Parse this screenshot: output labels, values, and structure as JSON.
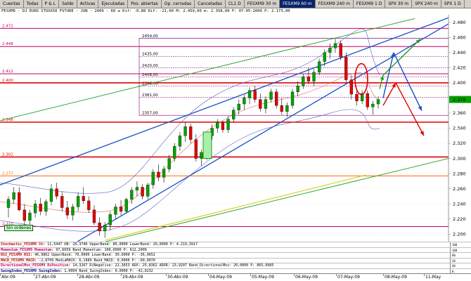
{
  "tabs": [
    {
      "label": "Cuentas",
      "active": false
    },
    {
      "label": "Todas",
      "active": false
    },
    {
      "label": "P & L",
      "active": false
    },
    {
      "label": "Saldo",
      "active": false
    },
    {
      "label": "Activas",
      "active": false
    },
    {
      "label": "Ejecutadas",
      "active": false
    },
    {
      "label": "Pos. abiertas",
      "active": false
    },
    {
      "label": "Op. cerradas",
      "active": false
    },
    {
      "label": "Canceladas",
      "active": false
    },
    {
      "label": "CL1 D",
      "active": false
    },
    {
      "label": "FESXM9 30 m",
      "active": false
    },
    {
      "label": "FESXM9 60 m",
      "active": true
    },
    {
      "label": "FESXM9 240 m",
      "active": false
    },
    {
      "label": "FESXM9 1 D",
      "active": false
    },
    {
      "label": "SPX 30 m",
      "active": false
    },
    {
      "label": "SPX 240 m",
      "active": false
    },
    {
      "label": "SPX 1 D",
      "active": false
    }
  ],
  "chart_header": "FESXM9 - DJ EURO STOXX50 FUTURE - JUN - 2009 - 60 w Dif: -0,88 Dif: -21,00 M: 2.459,00 m: 2.358,00 F: 07-05-2009 P: 2.173,00",
  "y_axis": {
    "ticks": [
      "2.480",
      "2.460",
      "2.440",
      "2.420",
      "2.400",
      "2.380",
      "2.360",
      "2.340",
      "2.320",
      "2.300",
      "2.280",
      "2.260",
      "2.240",
      "2.220",
      "2.200"
    ],
    "ylim": [
      2190,
      2490
    ],
    "last_price": "2.378",
    "last_price_color": "#00a000"
  },
  "horizontal_levels": [
    {
      "label": "2.472",
      "value": 2472,
      "color": "#c00060"
    },
    {
      "label": "2.448",
      "value": 2448,
      "color": "#c00060"
    },
    {
      "label": "2.412",
      "value": 2412,
      "color": "#c00060"
    },
    {
      "label": "2.400",
      "value": 2400,
      "color": "#e00000"
    },
    {
      "label": "2.348",
      "value": 2348,
      "color": "#e00000"
    },
    {
      "label": "2.302",
      "value": 2302,
      "color": "#e00000"
    },
    {
      "label": "2.277",
      "value": 2277,
      "color": "#ff6a00"
    },
    {
      "label": "2.210",
      "value": 2210,
      "color": "#c00060"
    }
  ],
  "fib_levels": [
    {
      "label": "2459,00",
      "value": 2459
    },
    {
      "label": "2435,00",
      "value": 2435
    },
    {
      "label": "2420,00",
      "value": 2420
    },
    {
      "label": "2408,00",
      "value": 2408
    },
    {
      "label": "2396,00",
      "value": 2396
    },
    {
      "label": "2381,00",
      "value": 2381
    },
    {
      "label": "2357,00",
      "value": 2357
    }
  ],
  "sin_ordenes": "Sin ordenes",
  "indicators": [
    {
      "name": "Stochastic_FESXM9 St:",
      "text": "11,5447 UB: 20,3740 UpperBand: 80,0000 LowerBand: 20,0000 P: 4.219,3917",
      "axis": "100"
    },
    {
      "name": "Momentum_FESXM9 Momentum:",
      "text": "97,6659 Band_Momentum: 100,0000 P: 612,2009",
      "axis": "100"
    },
    {
      "name": "RSI_FESXM9 RSI:",
      "text": "40,9862 UpperBand: 70,0000 LowerBand: 30,0000 P: -36,9652",
      "axis": "80"
    },
    {
      "name": "MACD_FESXM9 MACD:",
      "text": "-2,8709 MediaMACD: 6,1989 Band_MACD: 0,0000 P: -60,0070",
      "axis": "20"
    },
    {
      "name": "DirectionalMov_FESXM9 DiPositive:",
      "text": "14,3267 DiNegative: 22,3653 ADX: 25,8362 ADXR: 23,9207 Band_DirectionalMov: 20,0000 P: 865,9985",
      "axis": "40"
    },
    {
      "name": "SwingIndex_FESXM9 SwingIndex:",
      "text": "1,0004 Band_SwingIndex: 0,0000 P: -42,6232",
      "axis": "0"
    }
  ],
  "x_axis": {
    "labels": [
      "Abr-09",
      "27-Abr-09",
      "28-Abr-09",
      "29-Abr-09",
      "30-Abr-09",
      "04-May-09",
      "05-May-09",
      "06-May-09",
      "07-May-09",
      "08-May-09",
      "11-May"
    ]
  },
  "chart_data": {
    "type": "candlestick",
    "x_unit": "hourly bars",
    "ylim": [
      2190,
      2490
    ],
    "ohlc": [
      [
        2235,
        2250,
        2222,
        2246
      ],
      [
        2246,
        2262,
        2240,
        2255
      ],
      [
        2255,
        2262,
        2230,
        2232
      ],
      [
        2232,
        2240,
        2212,
        2218
      ],
      [
        2218,
        2232,
        2210,
        2228
      ],
      [
        2228,
        2245,
        2222,
        2240
      ],
      [
        2240,
        2248,
        2225,
        2230
      ],
      [
        2230,
        2246,
        2224,
        2243
      ],
      [
        2243,
        2266,
        2238,
        2260
      ],
      [
        2260,
        2268,
        2246,
        2250
      ],
      [
        2250,
        2256,
        2230,
        2235
      ],
      [
        2235,
        2244,
        2220,
        2225
      ],
      [
        2225,
        2240,
        2218,
        2236
      ],
      [
        2236,
        2255,
        2230,
        2250
      ],
      [
        2250,
        2262,
        2240,
        2244
      ],
      [
        2244,
        2250,
        2228,
        2232
      ],
      [
        2232,
        2238,
        2212,
        2215
      ],
      [
        2215,
        2222,
        2198,
        2204
      ],
      [
        2204,
        2216,
        2195,
        2212
      ],
      [
        2212,
        2230,
        2205,
        2226
      ],
      [
        2226,
        2240,
        2220,
        2236
      ],
      [
        2236,
        2245,
        2225,
        2230
      ],
      [
        2230,
        2248,
        2228,
        2246
      ],
      [
        2246,
        2262,
        2240,
        2258
      ],
      [
        2258,
        2270,
        2250,
        2262
      ],
      [
        2262,
        2266,
        2246,
        2250
      ],
      [
        2250,
        2268,
        2246,
        2265
      ],
      [
        2265,
        2286,
        2260,
        2282
      ],
      [
        2282,
        2292,
        2270,
        2275
      ],
      [
        2275,
        2290,
        2268,
        2286
      ],
      [
        2286,
        2305,
        2282,
        2300
      ],
      [
        2300,
        2320,
        2296,
        2316
      ],
      [
        2316,
        2335,
        2310,
        2330
      ],
      [
        2330,
        2348,
        2322,
        2342
      ],
      [
        2342,
        2346,
        2320,
        2325
      ],
      [
        2325,
        2332,
        2296,
        2300
      ],
      [
        2300,
        2312,
        2290,
        2308
      ],
      [
        2302,
        2332,
        2298,
        2330
      ],
      [
        2330,
        2345,
        2325,
        2340
      ],
      [
        2340,
        2352,
        2334,
        2348
      ],
      [
        2348,
        2350,
        2334,
        2338
      ],
      [
        2338,
        2356,
        2334,
        2352
      ],
      [
        2352,
        2368,
        2348,
        2364
      ],
      [
        2364,
        2378,
        2358,
        2372
      ],
      [
        2372,
        2384,
        2364,
        2380
      ],
      [
        2380,
        2394,
        2372,
        2390
      ],
      [
        2390,
        2396,
        2374,
        2378
      ],
      [
        2378,
        2386,
        2362,
        2366
      ],
      [
        2366,
        2382,
        2360,
        2378
      ],
      [
        2378,
        2392,
        2374,
        2388
      ],
      [
        2388,
        2392,
        2366,
        2370
      ],
      [
        2370,
        2380,
        2358,
        2362
      ],
      [
        2362,
        2374,
        2355,
        2370
      ],
      [
        2370,
        2392,
        2366,
        2388
      ],
      [
        2388,
        2402,
        2382,
        2396
      ],
      [
        2396,
        2412,
        2392,
        2408
      ],
      [
        2408,
        2420,
        2398,
        2402
      ],
      [
        2402,
        2418,
        2396,
        2414
      ],
      [
        2414,
        2432,
        2410,
        2428
      ],
      [
        2428,
        2444,
        2422,
        2440
      ],
      [
        2440,
        2452,
        2432,
        2446
      ],
      [
        2446,
        2459,
        2440,
        2452
      ],
      [
        2452,
        2456,
        2430,
        2434
      ],
      [
        2434,
        2440,
        2400,
        2404
      ],
      [
        2404,
        2410,
        2378,
        2385
      ],
      [
        2385,
        2392,
        2370,
        2376
      ],
      [
        2376,
        2390,
        2372,
        2386
      ],
      [
        2386,
        2390,
        2364,
        2368
      ],
      [
        2368,
        2376,
        2358,
        2372
      ],
      [
        2372,
        2382,
        2366,
        2378
      ]
    ]
  }
}
